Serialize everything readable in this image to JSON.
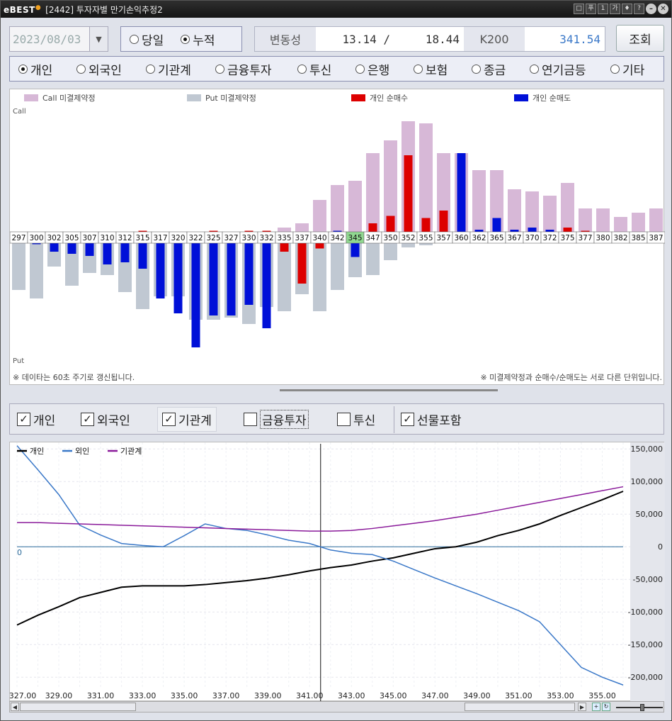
{
  "titlebar": {
    "logo": "eBEST",
    "title": "[2442] 투자자별 만기손익추정2",
    "buttons": [
      "□",
      "푸",
      "1",
      "가",
      "♦",
      "?"
    ]
  },
  "toolbar": {
    "date": "2023/08/03",
    "mode_options": [
      "당일",
      "누적"
    ],
    "mode_selected": "누적",
    "volatility_label": "변동성",
    "volatility_value1": "13.14",
    "volatility_sep": "/",
    "volatility_value2": "18.44",
    "k200_label": "K200",
    "k200_value": "341.54",
    "query_label": "조회"
  },
  "investors": {
    "options": [
      "개인",
      "외국인",
      "기관계",
      "금융투자",
      "투신",
      "은행",
      "보험",
      "종금",
      "연기금등",
      "기타"
    ],
    "selected": "개인"
  },
  "upper_chart": {
    "legend": [
      "Call 미결제약정",
      "Put 미결제약정",
      "개인 순매수",
      "개인 순매도"
    ],
    "call_label": "Call",
    "put_label": "Put",
    "footer_left": "※ 데이타는 60초 주기로 갱신됩니다.",
    "footer_right": "※ 미결제약정과 순매수/순매도는 서로 다른 단위입니다.",
    "colors": {
      "call_oi": "#d7b8d7",
      "put_oi": "#c0c8d2",
      "net_buy": "#dd0000",
      "net_sell": "#0010d8",
      "highlight": "#90d890"
    }
  },
  "chart_data": [
    {
      "type": "bar",
      "categories": [
        "297",
        "300",
        "302",
        "305",
        "307",
        "310",
        "312",
        "315",
        "317",
        "320",
        "322",
        "325",
        "327",
        "330",
        "332",
        "335",
        "337",
        "340",
        "342",
        "345",
        "347",
        "350",
        "352",
        "355",
        "357",
        "360",
        "362",
        "365",
        "367",
        "370",
        "372",
        "375",
        "377",
        "380",
        "382",
        "385",
        "387"
      ],
      "highlight_category": "345",
      "series": [
        {
          "name": "Call 미결제약정",
          "values": [
            0,
            0,
            0,
            0,
            0,
            0,
            0,
            0,
            0,
            0,
            0,
            0,
            0,
            0,
            0,
            2,
            4,
            15,
            22,
            24,
            37,
            43,
            52,
            51,
            37,
            37,
            29,
            29,
            20,
            19,
            17,
            23,
            11,
            11,
            7,
            9,
            11
          ]
        },
        {
          "name": "Put 미결제약정",
          "values": [
            -22,
            -26,
            -11,
            -20,
            -14,
            -15,
            -23,
            -31,
            -25,
            -25,
            -36,
            -36,
            -35,
            -38,
            -30,
            -32,
            -24,
            -32,
            -22,
            -16,
            -15,
            -8,
            -2,
            -1,
            0,
            0,
            0,
            0,
            0,
            0,
            0,
            0,
            0,
            0,
            0,
            0,
            0
          ]
        },
        {
          "name": "개인 순매수",
          "values": [
            0,
            0,
            0,
            0,
            0,
            0,
            0,
            0.5,
            0,
            0,
            0,
            0.5,
            0,
            0.5,
            0.5,
            -4,
            -19,
            -2.5,
            0,
            -5,
            4,
            7.5,
            36,
            6.5,
            10,
            0,
            0,
            0,
            0,
            0,
            0,
            2,
            0.5,
            0,
            0,
            0,
            0
          ]
        },
        {
          "name": "개인 순매도",
          "values": [
            0,
            -0.5,
            -4,
            -5,
            -6,
            -10,
            -9,
            -12,
            -26,
            -33,
            -49,
            -34,
            -34,
            -29,
            -40,
            0,
            0,
            0,
            0.5,
            -6.5,
            0,
            0,
            0,
            0,
            0,
            37,
            1,
            6.5,
            1,
            2,
            1,
            0,
            0,
            0,
            0,
            0,
            0
          ]
        }
      ]
    },
    {
      "type": "line",
      "x": [
        327,
        328,
        329,
        330,
        331,
        332,
        333,
        334,
        335,
        336,
        337,
        338,
        339,
        340,
        341,
        342,
        343,
        344,
        345,
        346,
        347,
        348,
        349,
        350,
        351,
        352,
        353,
        354,
        355,
        356
      ],
      "series": [
        {
          "name": "개인",
          "values": [
            -120,
            -105,
            -92,
            -78,
            -70,
            -62,
            -60,
            -60,
            -60,
            -58,
            -55,
            -52,
            -48,
            -43,
            -37,
            -32,
            -28,
            -22,
            -17,
            -10,
            -3,
            0,
            7,
            17,
            25,
            35,
            48,
            60,
            72,
            85
          ]
        },
        {
          "name": "외인",
          "values": [
            155,
            118,
            80,
            33,
            18,
            5,
            2,
            0,
            17,
            35,
            28,
            25,
            18,
            10,
            5,
            -5,
            -10,
            -12,
            -22,
            -35,
            -48,
            -60,
            -72,
            -85,
            -98,
            -115,
            -150,
            -185,
            -200,
            -212
          ]
        },
        {
          "name": "기관계",
          "values": [
            37,
            37,
            36,
            35,
            34,
            33,
            32,
            31,
            30,
            29,
            28,
            27,
            26,
            25,
            24,
            24,
            25,
            28,
            32,
            36,
            40,
            45,
            50,
            56,
            62,
            68,
            74,
            80,
            86,
            92
          ]
        }
      ],
      "xlim": [
        327,
        356
      ],
      "ylim": [
        -215,
        160
      ],
      "yticks": [
        150000,
        100000,
        50000,
        0,
        -50000,
        -100000,
        -150000,
        -200000
      ],
      "ytick_labels": [
        "150,000",
        "100,000",
        "50,000",
        "0",
        "-50,000",
        "-100,000",
        "-150,000",
        "-200,000"
      ],
      "xtick_labels": [
        "327.00",
        "329.00",
        "331.00",
        "333.00",
        "335.00",
        "337.00",
        "339.00",
        "341.00",
        "343.00",
        "345.00",
        "347.00",
        "349.00",
        "351.00",
        "353.00",
        "355.00"
      ],
      "zero_label": "0",
      "crosshair_x": 342,
      "colors": {
        "개인": "#000000",
        "외인": "#3a78c8",
        "기관계": "#8a1a9a"
      }
    }
  ],
  "lower_controls": {
    "checkboxes": [
      {
        "label": "개인",
        "checked": true
      },
      {
        "label": "외국인",
        "checked": true
      },
      {
        "label": "기관계",
        "checked": true
      },
      {
        "label": "금융투자",
        "checked": false
      },
      {
        "label": "투신",
        "checked": false
      }
    ],
    "futures_label": "선물포함",
    "futures_checked": true,
    "check_mark": "✓"
  },
  "lower_legend": [
    "개인",
    "외인",
    "기관계"
  ]
}
